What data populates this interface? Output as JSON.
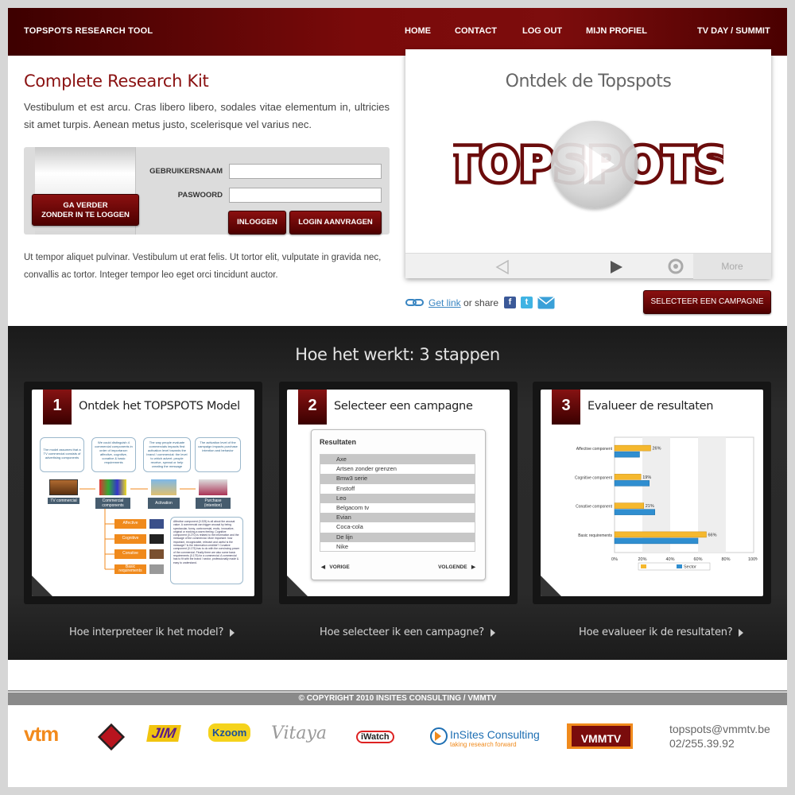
{
  "header": {
    "brand": "TOPSPOTS RESEARCH TOOL",
    "nav": [
      "HOME",
      "CONTACT",
      "LOG OUT",
      "MIJN PROFIEL",
      "TV DAY / SUMMIT"
    ]
  },
  "intro": {
    "title": "Complete Research Kit",
    "text": "Vestibulum et est arcu. Cras libero libero, sodales vitae elementum in, ultricies sit amet turpis. Aenean metus justo, scelerisque vel varius nec.",
    "text2": "Ut tempor aliquet pulvinar. Vestibulum ut erat felis. Ut tortor elit, vulputate in gravida nec, convallis ac tortor. Integer tempor leo eget orci tincidunt auctor."
  },
  "login": {
    "continue_line1": "GA VERDER",
    "continue_line2": "ZONDER IN TE LOGGEN",
    "username_label": "GEBRUIKERSNAAM",
    "password_label": "PASWOORD",
    "username_value": "",
    "password_value": "",
    "login_button": "INLOGGEN",
    "request_button": "LOGIN AANVRAGEN"
  },
  "video": {
    "title": "Ontdek de Topspots",
    "logo_text": "TOPSPOTS",
    "more": "More"
  },
  "share": {
    "get_link": "Get link",
    "or_share": "or share",
    "select_campaign": "SELECTEER EEN CAMPAGNE"
  },
  "steps": {
    "heading": "Hoe het werkt: 3 stappen",
    "items": [
      {
        "number": "1",
        "title": "Ontdek het TOPSPOTS Model",
        "link": "Hoe interpreteer ik het model?"
      },
      {
        "number": "2",
        "title": "Selecteer een campagne",
        "link": "Hoe selecteer ik een campagne?"
      },
      {
        "number": "3",
        "title": "Evalueer de resultaten",
        "link": "Hoe evalueer ik de resultaten?"
      }
    ]
  },
  "model": {
    "top_boxes": [
      "The model assumes that a TV commercial consists of advertising components",
      "We could distinguish 4 commercial components in order of importance: affective, cognitive, conative & basic requirements",
      "The way people evaluate commercials impacts first activation level towards the brand / commercial: the level to which advert. people receive, spread or help creating the message",
      "The activation level of the campaign impacts purchase intention and behavior"
    ],
    "flow": [
      "TV commercial",
      "Commercial components",
      "Activation",
      "Purchase (intention)"
    ],
    "components": [
      "Affective",
      "Cognitive",
      "Conative",
      "Basic requirements"
    ],
    "description": "Affective component (0.325) is all about the arousal value. A commercial can trigger arousal by being spectacular, funny, controversial, erotic, innovative, original or evoking a warm feeling. Cognitive component (0.270) is related to the information and the message of the commercial. More important: how important, recognizable, relevant and useful is the message? Is the information credible? Conative component (0.175) has to do with the convincing power of the commercial. Finally there are also some basic requirements (0.175) for a commercial. A commercial has to fit with the brand / sector, professionally made & easy to understand."
  },
  "results": {
    "heading": "Resultaten",
    "rows": [
      "Axe",
      "Artsen zonder grenzen",
      "Bmw3 serie",
      "Enstoff",
      "Leo",
      "Belgacom tv",
      "Evian",
      "Coca-cola",
      "De lijn",
      "Nike"
    ],
    "prev": "VORIGE",
    "next": "VOLGENDE"
  },
  "chart_data": {
    "type": "bar",
    "orientation": "horizontal",
    "categories": [
      "Affective component",
      "Cognitive component",
      "Conative component",
      "Basic requirements"
    ],
    "series": [
      {
        "name": "",
        "color": "#f5b82e",
        "values": [
          26,
          19,
          21,
          66
        ]
      },
      {
        "name": "Sector",
        "color": "#2f8ed0",
        "values": [
          18,
          25,
          29,
          60
        ]
      }
    ],
    "data_labels": [
      "26%",
      "19%",
      "21%",
      "66%"
    ],
    "xticks": [
      "0%",
      "20%",
      "40%",
      "60%",
      "80%",
      "100%"
    ],
    "xlim": [
      0,
      100
    ],
    "legend": "bottom"
  },
  "footer": {
    "copyright": "© COPYRIGHT 2010 INSITES CONSULTING  /  VMMTV",
    "logos": [
      "vtm",
      "2BE",
      "JIM",
      "Kzoom",
      "Vitaya",
      "iWatch",
      "InSites Consulting",
      "taking research forward",
      "VMMTV"
    ],
    "email": "topspots@vmmtv.be",
    "phone": "02/255.39.92"
  },
  "colors": {
    "brand": "#7a0a0a",
    "accent_blue": "#2f8ed0",
    "accent_yellow": "#f5b82e",
    "orange": "#f08a1c"
  }
}
